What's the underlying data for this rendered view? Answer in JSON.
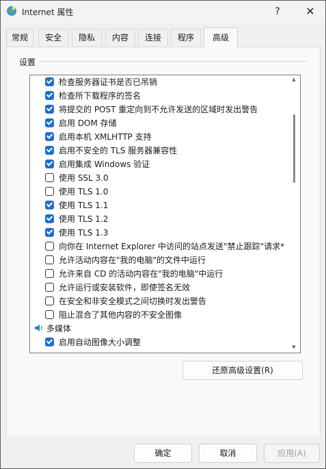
{
  "window": {
    "title": "Internet 属性",
    "help_label": "?",
    "close_label": "✕"
  },
  "tabs": [
    {
      "label": "常规"
    },
    {
      "label": "安全"
    },
    {
      "label": "隐私"
    },
    {
      "label": "内容"
    },
    {
      "label": "连接"
    },
    {
      "label": "程序"
    },
    {
      "label": "高级"
    }
  ],
  "settings": {
    "group_label": "设置",
    "items": [
      {
        "label": "检查服务器证书是否已吊销",
        "checked": true
      },
      {
        "label": "检查所下载程序的签名",
        "checked": true
      },
      {
        "label": "将提交的 POST 重定向到不允许发送的区域时发出警告",
        "checked": true
      },
      {
        "label": "启用 DOM 存储",
        "checked": true
      },
      {
        "label": "启用本机 XMLHTTP 支持",
        "checked": true
      },
      {
        "label": "启用不安全的 TLS 服务器兼容性",
        "checked": true
      },
      {
        "label": "启用集成 Windows 验证",
        "checked": true
      },
      {
        "label": "使用 SSL 3.0",
        "checked": false
      },
      {
        "label": "使用 TLS 1.0",
        "checked": false
      },
      {
        "label": "使用 TLS 1.1",
        "checked": true
      },
      {
        "label": "使用 TLS 1.2",
        "checked": true
      },
      {
        "label": "使用 TLS 1.3",
        "checked": true
      },
      {
        "label": "向你在 Internet Explorer 中访问的站点发送\"禁止跟踪\"请求*",
        "checked": false
      },
      {
        "label": "允许活动内容在\"我的电脑\"的文件中运行",
        "checked": false
      },
      {
        "label": "允许来自 CD 的活动内容在\"我的电脑\"中运行",
        "checked": false
      },
      {
        "label": "允许运行或安装软件，即使签名无效",
        "checked": false
      },
      {
        "label": "在安全和非安全模式之间切换时发出警告",
        "checked": false
      },
      {
        "label": "阻止混合了其他内容的不安全图像",
        "checked": false
      }
    ],
    "category_label": "多媒体",
    "partial_item": {
      "label": "启用自动图像大小调整",
      "checked": true
    }
  },
  "restore_button": "还原高级设置(R)",
  "footer": {
    "ok": "确定",
    "cancel": "取消",
    "apply": "应用(A)"
  }
}
